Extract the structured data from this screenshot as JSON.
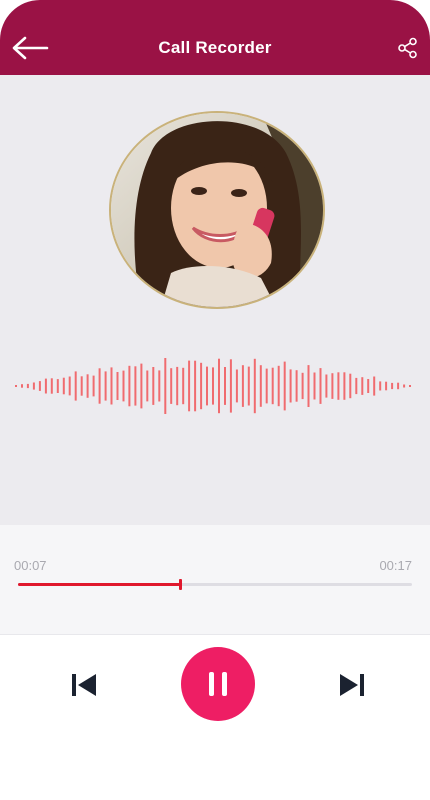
{
  "app": {
    "title": "Call Recorder"
  },
  "header": {
    "back_icon": "arrow-left-icon",
    "share_icon": "share-icon"
  },
  "player": {
    "elapsed": "00:07",
    "duration": "00:17",
    "progress": 0.41
  },
  "controls": {
    "prev_icon": "skip-previous-icon",
    "pause_icon": "pause-icon",
    "next_icon": "skip-next-icon"
  },
  "colors": {
    "appbar": "#9a1245",
    "accent": "#ee1e64",
    "progress": "#e0182d",
    "wave": "#f06b6f",
    "background": "#ecebef"
  }
}
